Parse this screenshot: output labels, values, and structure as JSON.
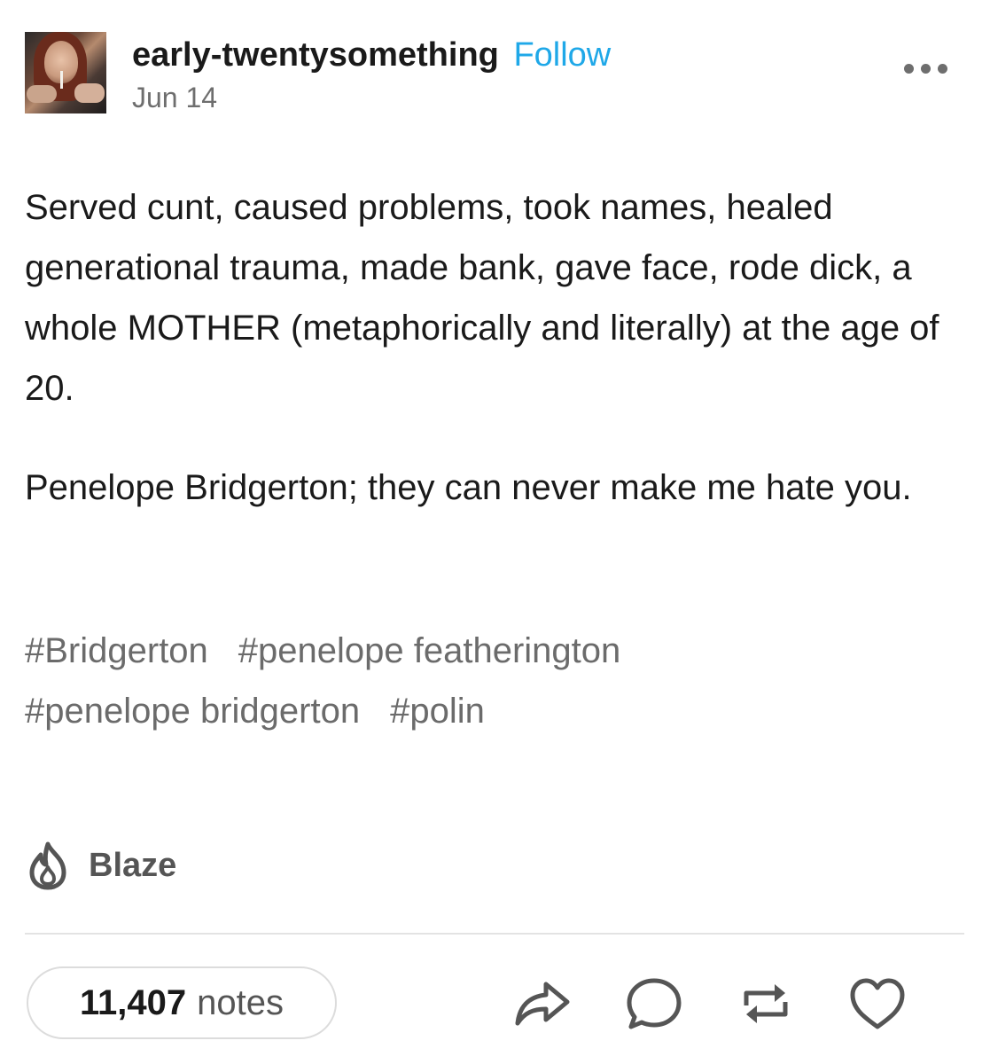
{
  "post": {
    "blog_name": "early-twentysomething",
    "follow_label": "Follow",
    "date": "Jun 14",
    "paragraphs": [
      "Served cunt, caused problems, took names, healed generational trauma, made bank, gave face, rode dick, a whole MOTHER (metaphorically and literally) at the age of 20.",
      "Penelope Bridgerton; they can never make me hate you."
    ],
    "tags": [
      "#Bridgerton",
      "#penelope featherington",
      "#penelope bridgerton",
      "#polin"
    ]
  },
  "blaze": {
    "label": "Blaze",
    "icon": "flame-icon"
  },
  "footer": {
    "notes_count": "11,407",
    "notes_label": "notes",
    "actions": [
      "share-icon",
      "reply-icon",
      "reblog-icon",
      "like-icon"
    ]
  },
  "colors": {
    "follow": "#1fa8e8",
    "muted": "#6e6e6e",
    "text": "#1a1a1a"
  }
}
